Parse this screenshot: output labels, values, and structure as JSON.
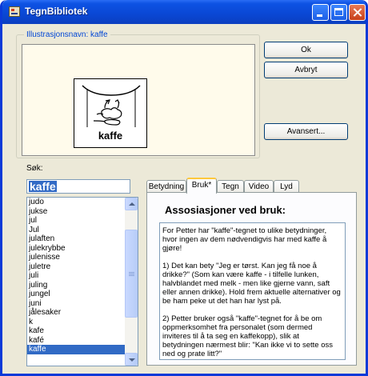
{
  "window": {
    "title": "TegnBibliotek"
  },
  "illustration": {
    "label": "Illustrasjonsnavn: kaffe",
    "word": "kaffe"
  },
  "buttons": {
    "ok": "Ok",
    "cancel": "Avbryt",
    "advanced": "Avansert..."
  },
  "search": {
    "label": "Søk:",
    "value": "kaffe"
  },
  "list": {
    "items": [
      "judo",
      "jukse",
      "jul",
      "Jul",
      "julaften",
      "julekrybbe",
      "julenisse",
      "juletre",
      "juli",
      "juling",
      "jungel",
      "juni",
      "jålesaker",
      "k",
      "kafe",
      "kafé",
      "kaffe"
    ],
    "selected": "kaffe"
  },
  "tabs": {
    "items": [
      "Betydning",
      "Bruk*",
      "Tegn",
      "Video",
      "Lyd"
    ],
    "active": "Bruk*"
  },
  "panel": {
    "title": "Assosiasjoner ved bruk:",
    "paragraphs": [
      "For Petter har \"kaffe\"-tegnet to ulike betydninger, hvor ingen av dem nødvendigvis har med kaffe å gjøre!",
      "1) Det kan bety \"Jeg er tørst. Kan jeg få noe å drikke?\" (Som kan være kaffe - i tilfelle lunken, halvblandet med melk - men like gjerne vann, saft eller annen drikke). Hold frem aktuelle alternativer og be ham peke ut det han har lyst på.",
      "2) Petter bruker også \"kaffe\"-tegnet for å be om oppmerksomhet fra personalet (som dermed inviteres til å ta seg en kaffekopp), slik at betydningen nærmest blir: \"Kan ikke vi to sette oss ned og prate litt?\""
    ]
  },
  "colors": {
    "titlebar": "#0a47d4",
    "selection": "#316ac5",
    "groupLabel": "#0046d5",
    "activeTabAccent": "#ffc83c"
  }
}
